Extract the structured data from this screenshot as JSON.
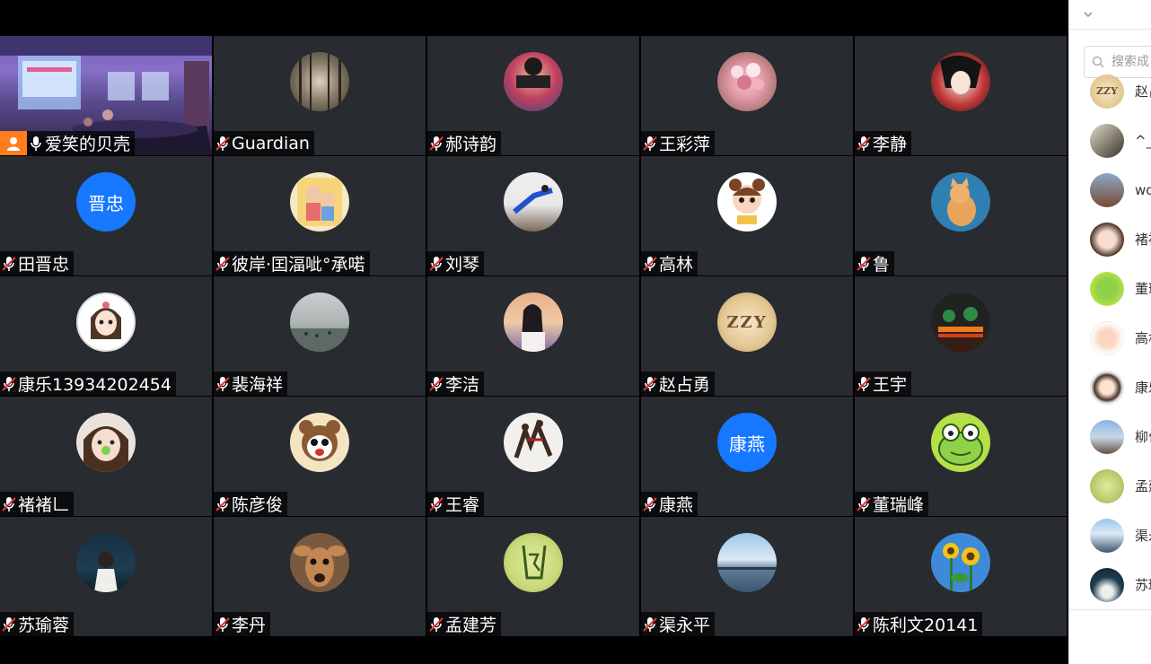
{
  "colors": {
    "tile_bg": "#282b30",
    "host_badge": "#ff7d1e",
    "active_border": "#2fd7b6",
    "text_avatar_bg": "#1677ff"
  },
  "participants": [
    {
      "name": "爱笑的贝壳",
      "host": true,
      "mic": "on",
      "video": true
    },
    {
      "name": "Guardian",
      "mic": "muted",
      "avatar": "forest-photo"
    },
    {
      "name": "郝诗韵",
      "mic": "muted",
      "avatar": "boy-photo"
    },
    {
      "name": "王彩萍",
      "mic": "muted",
      "avatar": "flowers-photo"
    },
    {
      "name": "李静",
      "mic": "muted",
      "avatar": "anime-photo"
    },
    {
      "name": "田晋忠",
      "mic": "muted",
      "avatar_text": "晋忠"
    },
    {
      "name": "彼岸·囯湢呲°承喏",
      "mic": "muted",
      "avatar": "cartoon-family"
    },
    {
      "name": "刘琴",
      "mic": "muted",
      "avatar": "dancer-photo"
    },
    {
      "name": "高林",
      "mic": "muted",
      "avatar": "cartoon-girl"
    },
    {
      "name": "鲁",
      "mic": "muted",
      "avatar": "cat-photo"
    },
    {
      "name": "康乐13934202454",
      "mic": "muted",
      "avatar": "doll-drawing"
    },
    {
      "name": "裴海祥",
      "mic": "muted",
      "avatar": "lake-photo"
    },
    {
      "name": "李洁",
      "mic": "muted",
      "avatar": "girl-sunset"
    },
    {
      "name": "赵占勇",
      "mic": "muted",
      "avatar_text": "ZZY"
    },
    {
      "name": "王宇",
      "mic": "muted",
      "avatar": "night-bridge"
    },
    {
      "name": "褚褚𠃊",
      "mic": "muted",
      "avatar": "girl-face"
    },
    {
      "name": "陈彦俊",
      "mic": "muted",
      "avatar": "cartoon-bear"
    },
    {
      "name": "王睿",
      "mic": "muted",
      "avatar": "dancers-photo"
    },
    {
      "name": "康燕",
      "mic": "muted",
      "avatar_text": "康燕"
    },
    {
      "name": "董瑞峰",
      "mic": "muted",
      "avatar": "frog-cartoon"
    },
    {
      "name": "苏瑜蓉",
      "mic": "muted",
      "avatar": "woman-dark"
    },
    {
      "name": "李丹",
      "mic": "muted",
      "avatar": "deer-photo"
    },
    {
      "name": "孟建芳",
      "mic": "muted",
      "avatar": "green-logo"
    },
    {
      "name": "渠永平",
      "mic": "muted",
      "avatar": "sea-photo"
    },
    {
      "name": "陈利文20141",
      "mic": "muted",
      "avatar": "sunflower-photo"
    }
  ],
  "sidebar": {
    "search_placeholder": "搜索成",
    "members": [
      {
        "name": "赵占",
        "avatar": "zzy"
      },
      {
        "name": "^_",
        "avatar": "dancer-dark"
      },
      {
        "name": "wo",
        "avatar": "building"
      },
      {
        "name": "褚褚",
        "avatar": "girl-face"
      },
      {
        "name": "董瑞",
        "avatar": "frog"
      },
      {
        "name": "高林",
        "avatar": "cartoon-girl"
      },
      {
        "name": "康乐",
        "avatar": "doll"
      },
      {
        "name": "柳位",
        "avatar": "city"
      },
      {
        "name": "孟建",
        "avatar": "green-logo"
      },
      {
        "name": "渠永",
        "avatar": "sea"
      },
      {
        "name": "苏瑜",
        "avatar": "woman-dark"
      }
    ]
  }
}
